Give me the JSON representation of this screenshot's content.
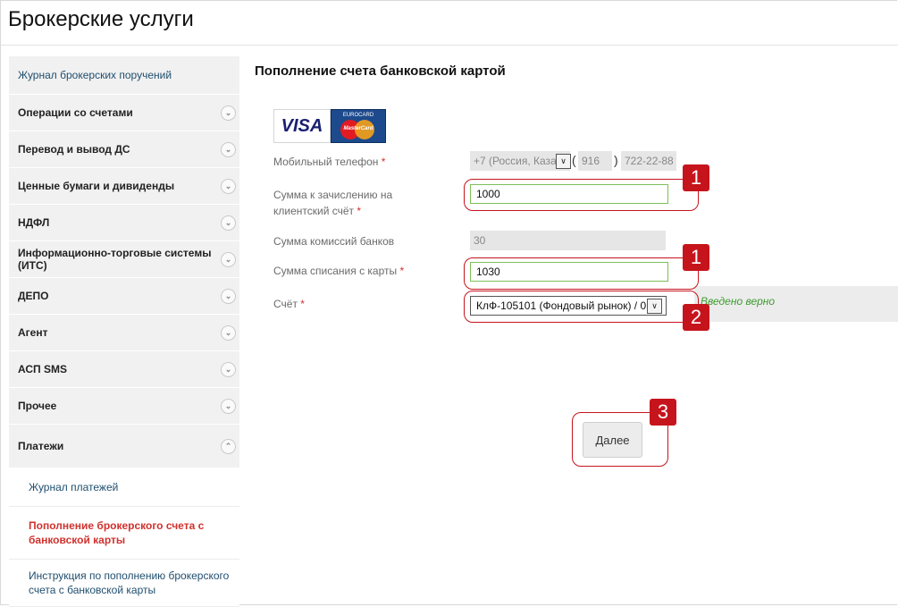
{
  "app": {
    "title": "Брокерские услуги"
  },
  "sidebar": {
    "top_item": "Журнал брокерских поручений",
    "items": [
      {
        "label": "Операции со счетами",
        "chevron": "chevron-down"
      },
      {
        "label": "Перевод и вывод ДС",
        "chevron": "chevron-down"
      },
      {
        "label": "Ценные бумаги и дивиденды",
        "chevron": "chevron-down"
      },
      {
        "label": "НДФЛ",
        "chevron": "chevron-down"
      },
      {
        "label": "Информационно-торговые системы (ИТС)",
        "chevron": "chevron-down"
      },
      {
        "label": "ДЕПО",
        "chevron": "chevron-down"
      },
      {
        "label": "Агент",
        "chevron": "chevron-down"
      },
      {
        "label": "АСП SMS",
        "chevron": "chevron-down"
      },
      {
        "label": "Прочее",
        "chevron": "chevron-down"
      },
      {
        "label": "Платежи",
        "chevron": "chevron-up"
      }
    ],
    "sub_items": [
      {
        "label": "Журнал платежей"
      },
      {
        "label": "Пополнение брокерского счета с банковской карты",
        "active": true
      },
      {
        "label": "Инструкция по пополнению брокерского счета с банковской карты"
      }
    ]
  },
  "main": {
    "title": "Пополнение счета банковской картой",
    "cards": {
      "visa": "VISA",
      "europay": "EUROCARD",
      "mastercard": "MasterCard"
    },
    "form": {
      "phone": {
        "label": "Мобильный телефон",
        "country": "+7 (Россия, Каза",
        "code": "916",
        "number": "722-22-88"
      },
      "amount_credit": {
        "label": "Сумма к зачислению на клиентский счёт",
        "value": "1000"
      },
      "bank_fee": {
        "label": "Сумма комиссий банков",
        "value": "30"
      },
      "amount_debit": {
        "label": "Сумма списания с карты",
        "value": "1030"
      },
      "account": {
        "label": "Счёт",
        "value": "КлФ-105101 (Фондовый рынок) / 0"
      },
      "required_mark": "*",
      "validation": "Введено верно"
    },
    "next_button": "Далее"
  },
  "annotations": {
    "badge_1": "1",
    "badge_2": "2",
    "badge_3": "3"
  },
  "colors": {
    "accent_red": "#c6141d",
    "valid_green": "#3d9b2f",
    "link_blue": "#1f4e6e"
  }
}
